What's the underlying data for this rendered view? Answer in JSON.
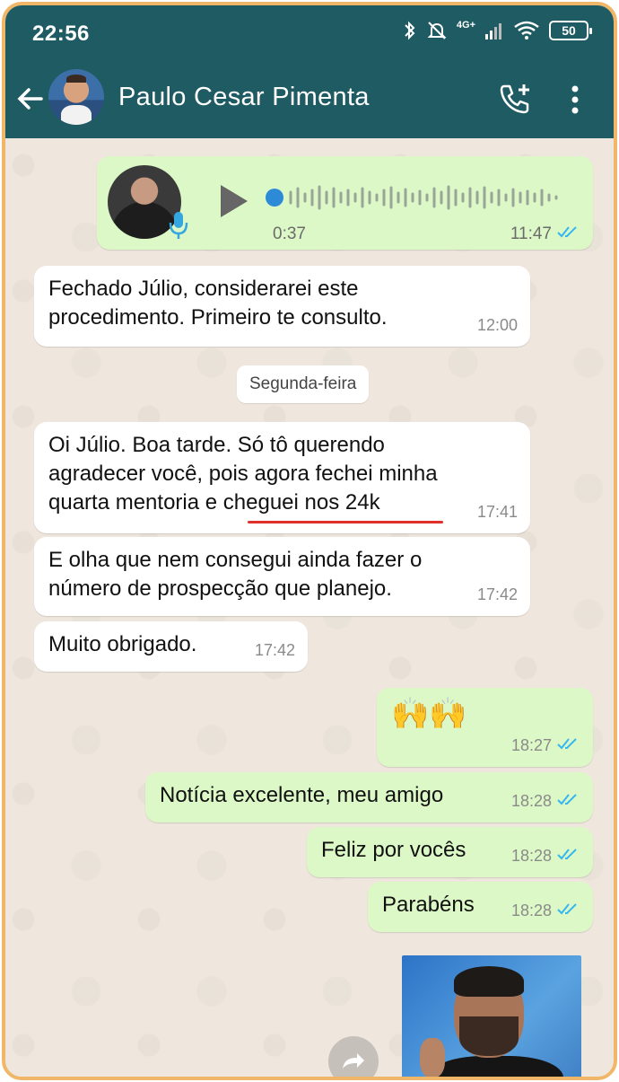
{
  "status_bar": {
    "time": "22:56",
    "network": "4G+",
    "battery": "50"
  },
  "header": {
    "contact_name": "Paulo Cesar Pimenta",
    "icons": [
      "back-arrow-icon",
      "add-call-icon",
      "more-vert-icon"
    ]
  },
  "chat": {
    "audio_message": {
      "duration": "0:37",
      "time": "11:47",
      "read": true
    },
    "messages_block1": [
      {
        "line1": "Fechado Júlio, considerarei este",
        "line2": "procedimento. Primeiro te consulto.",
        "time": "12:00"
      }
    ],
    "day_separator": "Segunda-feira",
    "messages_block2": [
      {
        "line1": "Oi Júlio. Boa tarde. Só tô querendo",
        "line2": "agradecer você, pois agora fechei minha",
        "line3": "quarta mentoria e cheguei nos 24k",
        "time": "17:41"
      },
      {
        "line1": "E olha que nem consegui ainda fazer o",
        "line2": "número de prospecção que planejo.",
        "time": "17:42"
      },
      {
        "line1": "Muito obrigado.",
        "time": "17:42"
      }
    ],
    "outgoing": [
      {
        "text": "🙌🙌",
        "time": "18:27"
      },
      {
        "text": "Notícia excelente, meu amigo",
        "time": "18:28"
      },
      {
        "text": "Feliz por vocês",
        "time": "18:28"
      },
      {
        "text": "Parabéns",
        "time": "18:28"
      }
    ]
  },
  "colors": {
    "header": "#1f5b63",
    "chat_bg": "#efe7dd",
    "incoming_bubble": "#ffffff",
    "outgoing_bubble": "#dcf8c6",
    "read_ticks": "#34b7f1",
    "highlight_underline": "#e0302b",
    "frame_border": "#f1b769"
  }
}
